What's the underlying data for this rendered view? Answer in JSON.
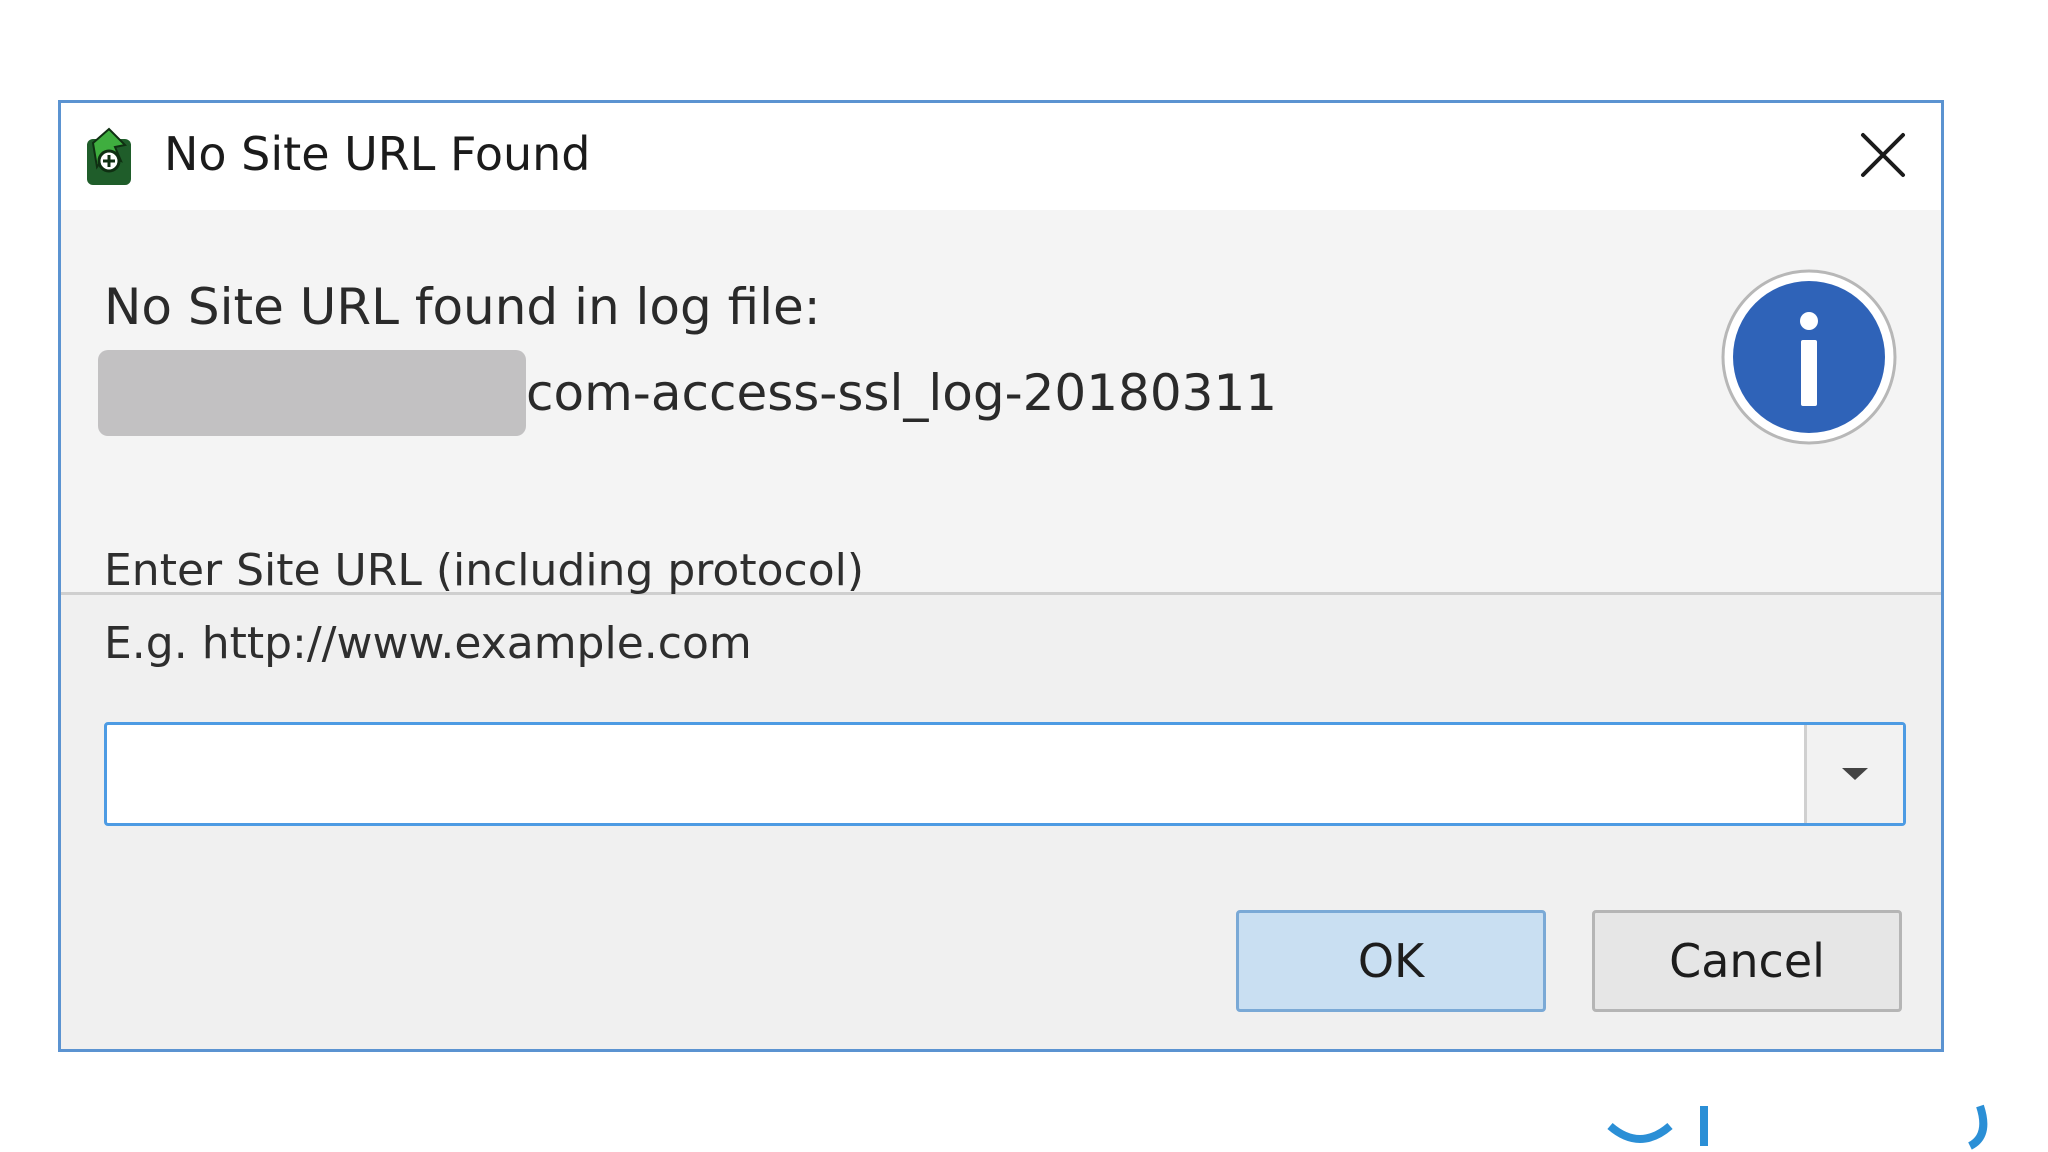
{
  "dialog": {
    "title": "No Site URL Found",
    "close_icon": "close-icon",
    "app_icon": "app-icon",
    "message": {
      "line1": "No Site URL found in log file:",
      "filename_suffix": "com-access-ssl_log-20180311"
    },
    "info_icon": "info-icon",
    "prompt": {
      "label_line1": "Enter Site URL (including protocol)",
      "label_line2": "E.g. http://www.example.com"
    },
    "url_input": {
      "value": "",
      "placeholder": ""
    },
    "buttons": {
      "ok": "OK",
      "cancel": "Cancel"
    }
  },
  "colors": {
    "accent_border": "#5b93d1",
    "info_blue": "#2f63b8",
    "ok_button": "#c9dff2"
  }
}
